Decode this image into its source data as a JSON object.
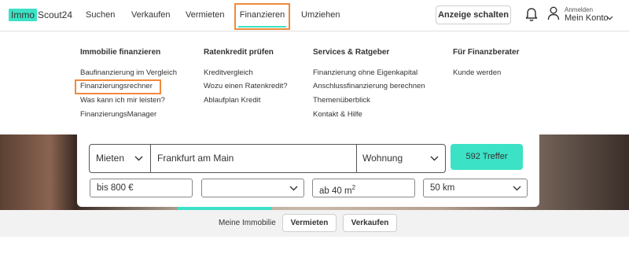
{
  "logo": {
    "box_text": "Immo",
    "rest_text": "Scout24",
    "brand_color": "#3ce2c6"
  },
  "nav": {
    "items": [
      "Suchen",
      "Verkaufen",
      "Vermieten",
      "Finanzieren",
      "Umziehen"
    ],
    "active": "Finanzieren",
    "highlight_color": "#f08a3c"
  },
  "header": {
    "cta_label": "Anzeige schalten",
    "bell_icon": "bell-icon",
    "account_small": "Anmelden",
    "account_main": "Mein Konto",
    "account_icon": "person-icon"
  },
  "menu": {
    "columns": [
      {
        "heading": "Immobilie finanzieren",
        "links": [
          "Baufinanzierung im Vergleich",
          "Finanzierungsrechner",
          "Was kann ich mir leisten?",
          "FinanzierungsManager"
        ]
      },
      {
        "heading": "Ratenkredit prüfen",
        "links": [
          "Kreditvergleich",
          "Wozu einen Ratenkredit?",
          "Ablaufplan Kredit"
        ]
      },
      {
        "heading": "Services & Ratgeber",
        "links": [
          "Finanzierung ohne Eigenkapital",
          "Anschlussfinanzierung berechnen",
          "Themenüberblick",
          "Kontakt & Hilfe"
        ]
      },
      {
        "heading": "Für Finanzberater",
        "links": [
          "Kunde werden"
        ]
      }
    ],
    "highlighted_link": "Finanzierungsrechner"
  },
  "search": {
    "type": "Mieten",
    "location": "Frankfurt am Main",
    "property": "Wohnung",
    "results_button": "592 Treffer",
    "price": "bis 800 €",
    "rooms": "",
    "area_value": "ab 40 m",
    "area_unit": "2",
    "radius": "50 km"
  },
  "bottom": {
    "label": "Meine Immobilie",
    "btn1": "Vermieten",
    "btn2": "Verkaufen"
  }
}
